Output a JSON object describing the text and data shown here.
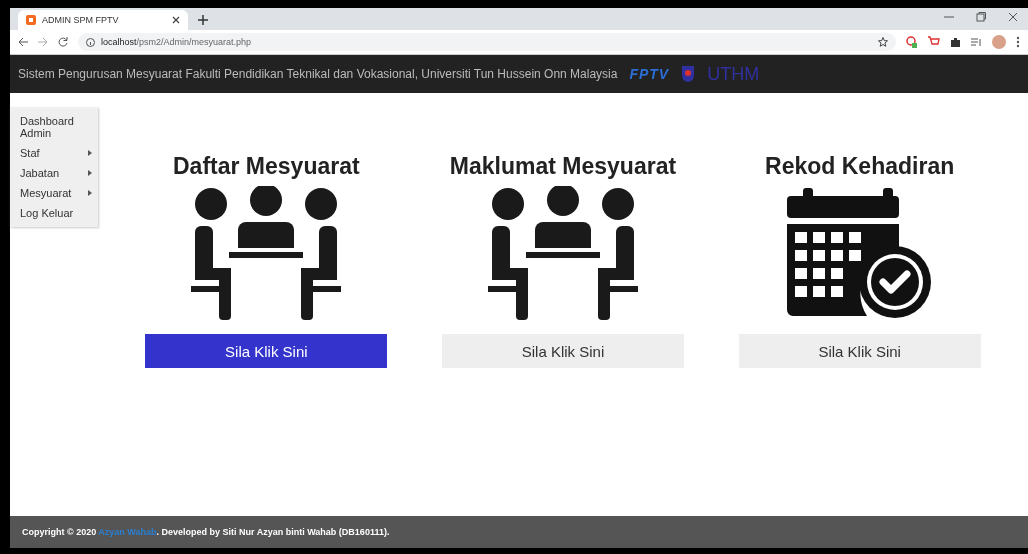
{
  "browser": {
    "tab_title": "ADMIN SPM FPTV",
    "url_host": "localhost",
    "url_path": "/psm2/Admin/mesyuarat.php"
  },
  "header": {
    "title": "Sistem Pengurusan Mesyuarat Fakulti Pendidikan Teknikal dan Vokasional, Universiti Tun Hussein Onn Malaysia",
    "logos": [
      "FPTV",
      "UTHM"
    ]
  },
  "sidebar": {
    "items": [
      {
        "label": "Dashboard Admin",
        "submenu": false
      },
      {
        "label": "Staf",
        "submenu": true
      },
      {
        "label": "Jabatan",
        "submenu": true
      },
      {
        "label": "Mesyuarat",
        "submenu": true
      },
      {
        "label": "Log Keluar",
        "submenu": false
      }
    ]
  },
  "cards": [
    {
      "title": "Daftar Mesyuarat",
      "kind": "meeting",
      "button": "Sila Klik Sini",
      "selected": true
    },
    {
      "title": "Maklumat Mesyuarat",
      "kind": "meeting",
      "button": "Sila Klik Sini",
      "selected": false
    },
    {
      "title": "Rekod Kehadiran",
      "kind": "calendar",
      "button": "Sila Klik Sini",
      "selected": false
    }
  ],
  "footer": {
    "prefix": "Copyright © 2020",
    "link": "Azyan Wahab",
    "suffix": ". Developed by Siti Nur Azyan binti Wahab (DB160111)."
  }
}
